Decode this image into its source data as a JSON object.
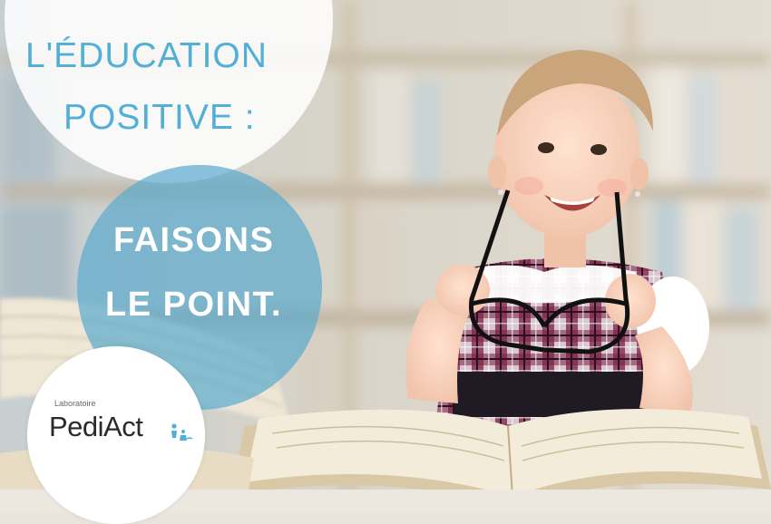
{
  "headline": {
    "line1": "L'ÉDUCATION",
    "line2": "POSITIVE :",
    "color": "#52b0d7"
  },
  "subheadline": {
    "line1": "FAISONS",
    "line2": "LE POINT.",
    "color": "#ffffff",
    "circle_color": "#5aaacd"
  },
  "logo": {
    "small_label": "Laboratoire",
    "brand": "PediAct",
    "brand_color": "#2a2a2a",
    "accent_color": "#52b0d7",
    "icon": "family-figures-icon"
  },
  "photo": {
    "subject_icon": "toddler-with-glasses-icon",
    "prop_icon": "open-book-icon"
  }
}
